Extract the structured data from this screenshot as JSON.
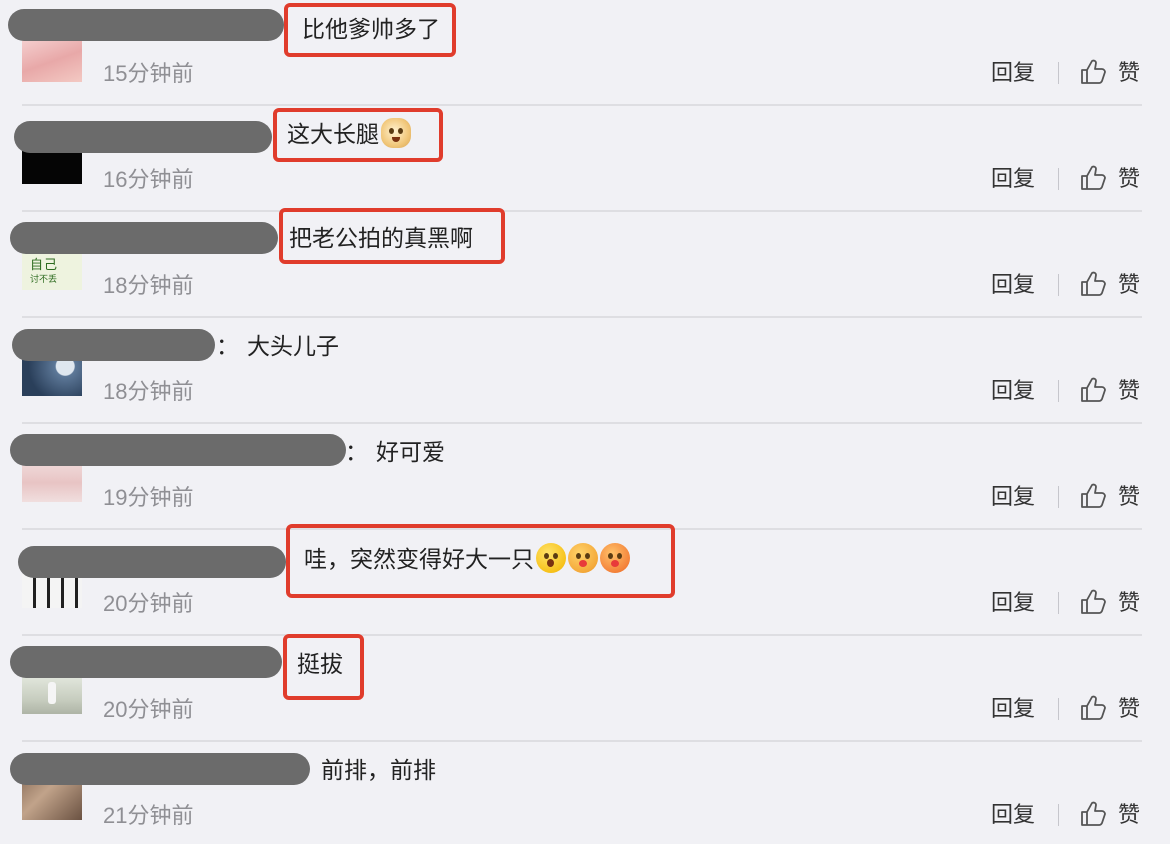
{
  "comments": [
    {
      "text": "比他爹帅多了",
      "time": "15分钟前",
      "reply": "回复",
      "like": "赞",
      "emojis": []
    },
    {
      "text": "这大长腿",
      "time": "16分钟前",
      "reply": "回复",
      "like": "赞",
      "emojis": [
        "doge-emoji"
      ]
    },
    {
      "text": "把老公拍的真黑啊",
      "time": "18分钟前",
      "reply": "回复",
      "like": "赞",
      "emojis": []
    },
    {
      "text": "大头儿子",
      "time": "18分钟前",
      "reply": "回复",
      "like": "赞",
      "emojis": []
    },
    {
      "text": "好可爱",
      "time": "19分钟前",
      "reply": "回复",
      "like": "赞",
      "emojis": []
    },
    {
      "text": "哇，突然变得好大一只",
      "time": "20分钟前",
      "reply": "回复",
      "like": "赞",
      "emojis": [
        "shocked-emoji",
        "kiss-emoji",
        "love-emoji"
      ]
    },
    {
      "text": "挺拔",
      "time": "20分钟前",
      "reply": "回复",
      "like": "赞",
      "emojis": []
    },
    {
      "text": "前排，前排",
      "time": "21分钟前",
      "reply": "回复",
      "like": "赞",
      "emojis": []
    }
  ],
  "avatar_texts": {
    "line1": "自己",
    "line2": "讨不丢"
  },
  "colon": "：",
  "colors": {
    "highlight": "#e03c2c",
    "background": "#f1f1f5",
    "redaction": "#6b6b6b",
    "time_text": "#8f8f94"
  }
}
